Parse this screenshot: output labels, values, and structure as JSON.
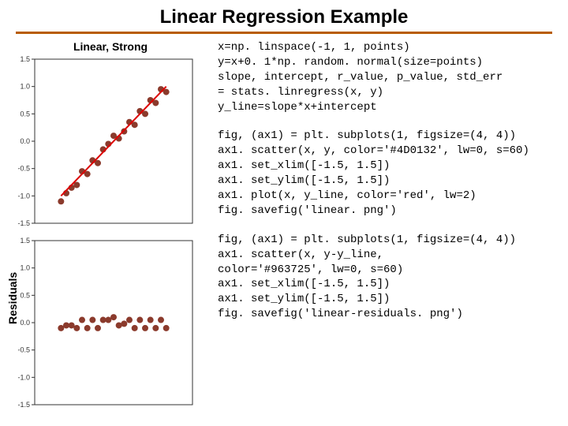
{
  "title": "Linear Regression Example",
  "left_label": "Residuals",
  "code_blocks": [
    "x=np. linspace(-1, 1, points)\ny=x+0. 1*np. random. normal(size=points)\nslope, intercept, r_value, p_value, std_err\n= stats. linregress(x, y)\ny_line=slope*x+intercept",
    "fig, (ax1) = plt. subplots(1, figsize=(4, 4))\nax1. scatter(x, y, color='#4D0132', lw=0, s=60)\nax1. set_xlim([-1.5, 1.5])\nax1. set_ylim([-1.5, 1.5])\nax1. plot(x, y_line, color='red', lw=2)\nfig. savefig('linear. png')",
    "fig, (ax1) = plt. subplots(1, figsize=(4, 4))\nax1. scatter(x, y-y_line,\ncolor='#963725', lw=0, s=60)\nax1. set_xlim([-1.5, 1.5])\nax1. set_ylim([-1.5, 1.5])\nfig. savefig('linear-residuals. png')"
  ],
  "chart_data": [
    {
      "type": "scatter",
      "title": "Linear, Strong",
      "xlim": [
        -1.5,
        1.5
      ],
      "ylim": [
        -1.5,
        1.5
      ],
      "yticks": [
        -1.5,
        -1.0,
        -0.5,
        0.0,
        0.5,
        1.0,
        1.5
      ],
      "points": [
        {
          "x": -1.0,
          "y": -1.1
        },
        {
          "x": -0.9,
          "y": -0.95
        },
        {
          "x": -0.8,
          "y": -0.85
        },
        {
          "x": -0.7,
          "y": -0.8
        },
        {
          "x": -0.6,
          "y": -0.55
        },
        {
          "x": -0.5,
          "y": -0.6
        },
        {
          "x": -0.4,
          "y": -0.35
        },
        {
          "x": -0.3,
          "y": -0.4
        },
        {
          "x": -0.2,
          "y": -0.15
        },
        {
          "x": -0.1,
          "y": -0.05
        },
        {
          "x": 0.0,
          "y": 0.1
        },
        {
          "x": 0.1,
          "y": 0.05
        },
        {
          "x": 0.2,
          "y": 0.18
        },
        {
          "x": 0.3,
          "y": 0.35
        },
        {
          "x": 0.4,
          "y": 0.3
        },
        {
          "x": 0.5,
          "y": 0.55
        },
        {
          "x": 0.6,
          "y": 0.5
        },
        {
          "x": 0.7,
          "y": 0.75
        },
        {
          "x": 0.8,
          "y": 0.7
        },
        {
          "x": 0.9,
          "y": 0.95
        },
        {
          "x": 1.0,
          "y": 0.9
        }
      ],
      "fit_line": {
        "x1": -1.0,
        "y1": -1.0,
        "x2": 1.0,
        "y2": 1.0
      }
    },
    {
      "type": "scatter",
      "title": "",
      "xlim": [
        -1.5,
        1.5
      ],
      "ylim": [
        -1.5,
        1.5
      ],
      "yticks": [
        -1.5,
        -1.0,
        -0.5,
        0.0,
        0.5,
        1.0,
        1.5
      ],
      "points": [
        {
          "x": -1.0,
          "y": -0.1
        },
        {
          "x": -0.9,
          "y": -0.05
        },
        {
          "x": -0.8,
          "y": -0.05
        },
        {
          "x": -0.7,
          "y": -0.1
        },
        {
          "x": -0.6,
          "y": 0.05
        },
        {
          "x": -0.5,
          "y": -0.1
        },
        {
          "x": -0.4,
          "y": 0.05
        },
        {
          "x": -0.3,
          "y": -0.1
        },
        {
          "x": -0.2,
          "y": 0.05
        },
        {
          "x": -0.1,
          "y": 0.05
        },
        {
          "x": 0.0,
          "y": 0.1
        },
        {
          "x": 0.1,
          "y": -0.05
        },
        {
          "x": 0.2,
          "y": -0.02
        },
        {
          "x": 0.3,
          "y": 0.05
        },
        {
          "x": 0.4,
          "y": -0.1
        },
        {
          "x": 0.5,
          "y": 0.05
        },
        {
          "x": 0.6,
          "y": -0.1
        },
        {
          "x": 0.7,
          "y": 0.05
        },
        {
          "x": 0.8,
          "y": -0.1
        },
        {
          "x": 0.9,
          "y": 0.05
        },
        {
          "x": 1.0,
          "y": -0.1
        }
      ]
    }
  ]
}
